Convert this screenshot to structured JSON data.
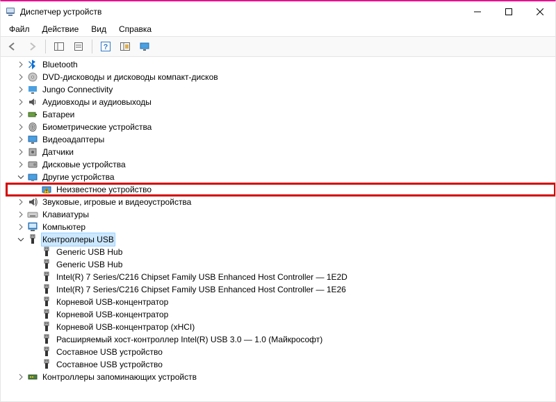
{
  "title": "Диспетчер устройств",
  "menu": [
    "Файл",
    "Действие",
    "Вид",
    "Справка"
  ],
  "tree": [
    {
      "lvl": 0,
      "exp": "c",
      "icon": "bluetooth",
      "label": "Bluetooth"
    },
    {
      "lvl": 0,
      "exp": "c",
      "icon": "dvd",
      "label": "DVD-дисководы и дисководы компакт-дисков"
    },
    {
      "lvl": 0,
      "exp": "c",
      "icon": "jungo",
      "label": "Jungo Connectivity"
    },
    {
      "lvl": 0,
      "exp": "c",
      "icon": "audio",
      "label": "Аудиовходы и аудиовыходы"
    },
    {
      "lvl": 0,
      "exp": "c",
      "icon": "battery",
      "label": "Батареи"
    },
    {
      "lvl": 0,
      "exp": "c",
      "icon": "biometric",
      "label": "Биометрические устройства"
    },
    {
      "lvl": 0,
      "exp": "c",
      "icon": "video",
      "label": "Видеоадаптеры"
    },
    {
      "lvl": 0,
      "exp": "c",
      "icon": "sensor",
      "label": "Датчики"
    },
    {
      "lvl": 0,
      "exp": "c",
      "icon": "disk",
      "label": "Дисковые устройства"
    },
    {
      "lvl": 0,
      "exp": "o",
      "icon": "other",
      "label": "Другие устройства"
    },
    {
      "lvl": 1,
      "exp": "",
      "icon": "warn",
      "label": "Неизвестное устройство",
      "highlight": true
    },
    {
      "lvl": 0,
      "exp": "c",
      "icon": "sound",
      "label": "Звуковые, игровые и видеоустройства"
    },
    {
      "lvl": 0,
      "exp": "c",
      "icon": "keyboard",
      "label": "Клавиатуры"
    },
    {
      "lvl": 0,
      "exp": "c",
      "icon": "computer",
      "label": "Компьютер"
    },
    {
      "lvl": 0,
      "exp": "o",
      "icon": "usbctrl",
      "label": "Контроллеры USB",
      "selected": true
    },
    {
      "lvl": 1,
      "exp": "",
      "icon": "usb",
      "label": "Generic USB Hub"
    },
    {
      "lvl": 1,
      "exp": "",
      "icon": "usb",
      "label": "Generic USB Hub"
    },
    {
      "lvl": 1,
      "exp": "",
      "icon": "usb",
      "label": "Intel(R) 7 Series/C216 Chipset Family USB Enhanced Host Controller — 1E2D"
    },
    {
      "lvl": 1,
      "exp": "",
      "icon": "usb",
      "label": "Intel(R) 7 Series/C216 Chipset Family USB Enhanced Host Controller — 1E26"
    },
    {
      "lvl": 1,
      "exp": "",
      "icon": "usb",
      "label": "Корневой USB-концентратор"
    },
    {
      "lvl": 1,
      "exp": "",
      "icon": "usb",
      "label": "Корневой USB-концентратор"
    },
    {
      "lvl": 1,
      "exp": "",
      "icon": "usb",
      "label": "Корневой USB-концентратор (xHCI)"
    },
    {
      "lvl": 1,
      "exp": "",
      "icon": "usb",
      "label": "Расширяемый хост-контроллер Intel(R) USB 3.0 — 1.0 (Майкрософт)"
    },
    {
      "lvl": 1,
      "exp": "",
      "icon": "usb",
      "label": "Составное USB устройство"
    },
    {
      "lvl": 1,
      "exp": "",
      "icon": "usb",
      "label": "Составное USB устройство"
    },
    {
      "lvl": 0,
      "exp": "c",
      "icon": "storagectrl",
      "label": "Контроллеры запоминающих устройств"
    }
  ]
}
